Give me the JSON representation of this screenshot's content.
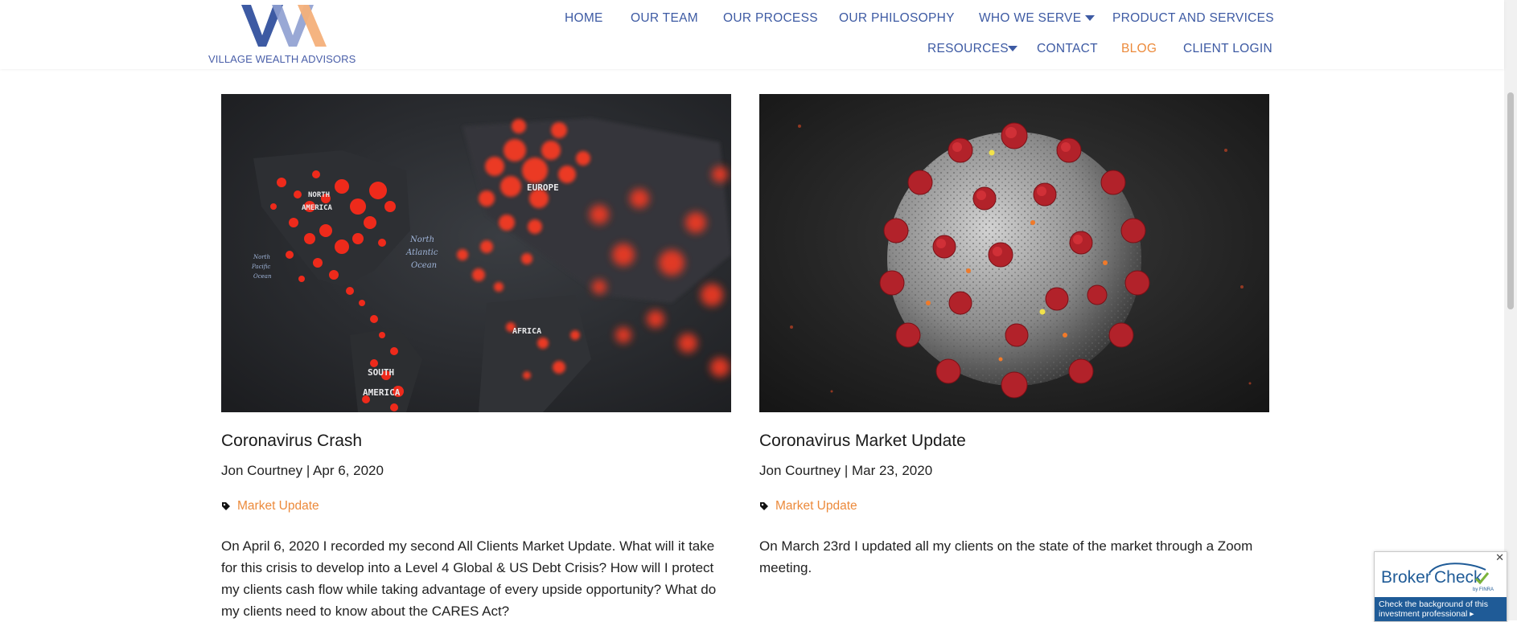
{
  "brand": {
    "name": "VILLAGE WEALTH ADVISORS",
    "colors": {
      "blue": "#3d5aa3",
      "light_blue": "#8e9fd0",
      "orange": "#ec8a3b"
    }
  },
  "nav": {
    "home": "HOME",
    "our_team": "OUR TEAM",
    "our_process": "OUR PROCESS",
    "our_philosophy": "OUR PHILOSOPHY",
    "who_we_serve": "WHO WE SERVE",
    "product_and_services": "PRODUCT AND SERVICES",
    "resources": "RESOURCES",
    "contact": "CONTACT",
    "blog": "BLOG",
    "client_login": "CLIENT LOGIN",
    "active_item": "BLOG"
  },
  "posts": [
    {
      "title": "Coronavirus Crash",
      "meta": "Jon Courtney | Apr 6, 2020",
      "tag": "Market Update",
      "excerpt": "On April 6, 2020 I recorded my second All Clients Market Update. What will it take for this crisis to develop into a Level 4 Global & US Debt Crisis? How will I protect my clients cash flow while taking advantage of every upside opportunity? What do my clients need to know about the CARES Act?",
      "image_labels": {
        "north_america_1": "NORTH",
        "north_america_2": "AMERICA",
        "ocean_1": "North",
        "ocean_2": "Atlantic",
        "ocean_3": "Ocean",
        "south_america_1": "SOUTH",
        "south_america_2": "AMERICA",
        "africa": "AFRICA",
        "europe": "EUROPE",
        "pacific_1": "North",
        "pacific_2": "Pacific",
        "pacific_3": "Ocean"
      }
    },
    {
      "title": "Coronavirus Market Update",
      "meta": "Jon Courtney | Mar 23, 2020",
      "tag": "Market Update",
      "excerpt": "On March 23rd I updated all my clients on the state of the market through a Zoom meeting."
    }
  ],
  "brokercheck": {
    "brand_1": "Broker",
    "brand_2": "Check",
    "byline": "by FINRA",
    "cta": "Check the background of this investment professional",
    "close": "✕"
  }
}
